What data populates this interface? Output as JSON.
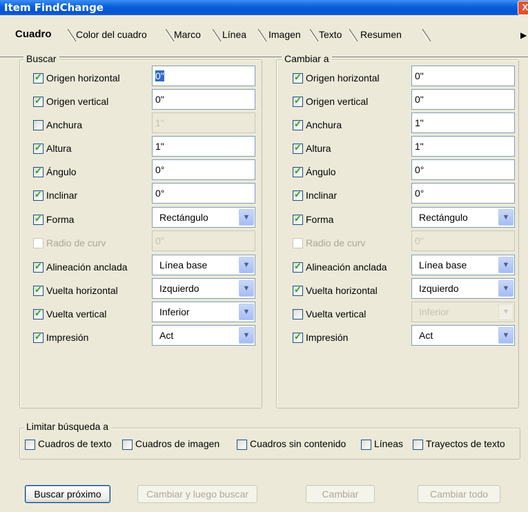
{
  "window": {
    "title": "Item FindChange",
    "close_glyph": "X"
  },
  "tabs": [
    {
      "label": "Cuadro",
      "selected": true
    },
    {
      "label": "Color del cuadro"
    },
    {
      "label": "Marco"
    },
    {
      "label": "Línea"
    },
    {
      "label": "Imagen"
    },
    {
      "label": "Texto"
    },
    {
      "label": "Resumen"
    }
  ],
  "tab_scroll_glyph": "▶",
  "find": {
    "label": "Buscar",
    "rows": [
      {
        "label": "Origen horizontal",
        "checked": true,
        "type": "text",
        "value": "0\"",
        "selected": true
      },
      {
        "label": "Origen vertical",
        "checked": true,
        "type": "text",
        "value": "0\""
      },
      {
        "label": "Anchura",
        "checked": false,
        "type": "text",
        "value": "1\"",
        "disabled": true
      },
      {
        "label": "Altura",
        "checked": true,
        "type": "text",
        "value": "1\""
      },
      {
        "label": "Ángulo",
        "checked": true,
        "type": "text",
        "value": "0°"
      },
      {
        "label": "Inclinar",
        "checked": true,
        "type": "text",
        "value": "0°"
      },
      {
        "label": "Forma",
        "checked": true,
        "type": "select",
        "value": "Rectángulo"
      },
      {
        "label": "Radio de curv",
        "checked": false,
        "type": "text",
        "value": "0\"",
        "disabled": true,
        "label_disabled": true
      },
      {
        "label": "Alineación anclada",
        "checked": true,
        "type": "select",
        "value": "Línea base"
      },
      {
        "label": "Vuelta horizontal",
        "checked": true,
        "type": "select",
        "value": "Izquierdo"
      },
      {
        "label": "Vuelta vertical",
        "checked": true,
        "type": "select",
        "value": "Inferior"
      },
      {
        "label": "Impresión",
        "checked": true,
        "type": "select",
        "value": "Act"
      }
    ]
  },
  "change": {
    "label": "Cambiar a",
    "rows": [
      {
        "label": "Origen horizontal",
        "checked": true,
        "type": "text",
        "value": "0\""
      },
      {
        "label": "Origen vertical",
        "checked": true,
        "type": "text",
        "value": "0\""
      },
      {
        "label": "Anchura",
        "checked": true,
        "type": "text",
        "value": "1\""
      },
      {
        "label": "Altura",
        "checked": true,
        "type": "text",
        "value": "1\""
      },
      {
        "label": "Ángulo",
        "checked": true,
        "type": "text",
        "value": "0°"
      },
      {
        "label": "Inclinar",
        "checked": true,
        "type": "text",
        "value": "0°"
      },
      {
        "label": "Forma",
        "checked": true,
        "type": "select",
        "value": "Rectángulo"
      },
      {
        "label": "Radio de curv",
        "checked": false,
        "type": "text",
        "value": "0\"",
        "disabled": true,
        "label_disabled": true
      },
      {
        "label": "Alineación anclada",
        "checked": true,
        "type": "select",
        "value": "Línea base"
      },
      {
        "label": "Vuelta horizontal",
        "checked": true,
        "type": "select",
        "value": "Izquierdo"
      },
      {
        "label": "Vuelta vertical",
        "checked": false,
        "type": "select",
        "value": "Inferior",
        "disabled": true
      },
      {
        "label": "Impresión",
        "checked": true,
        "type": "select",
        "value": "Act"
      }
    ]
  },
  "limit": {
    "label": "Limitar búsqueda a",
    "options": [
      {
        "label": "Cuadros de texto",
        "checked": false
      },
      {
        "label": "Cuadros de imagen",
        "checked": false
      },
      {
        "label": "Cuadros sin contenido",
        "checked": false
      },
      {
        "label": "Líneas",
        "checked": false
      },
      {
        "label": "Trayectos de texto",
        "checked": false
      }
    ]
  },
  "buttons": {
    "find_next": "Buscar próximo",
    "change_then_find": "Cambiar y luego buscar",
    "change": "Cambiar",
    "change_all": "Cambiar todo"
  }
}
